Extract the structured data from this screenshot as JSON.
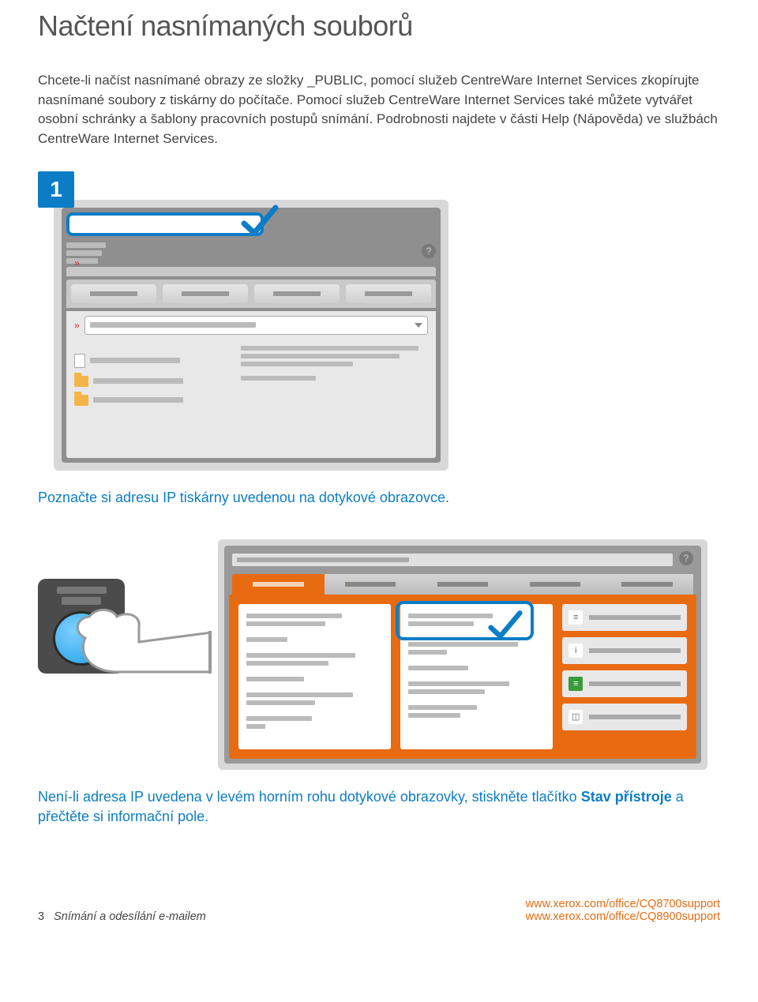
{
  "title": "Načtení nasnímaných souborů",
  "intro": "Chcete-li načíst nasnímané obrazy ze složky _PUBLIC, pomocí služeb CentreWare Internet Services zkopírujte nasnímané soubory z tiskárny do počítače. Pomocí služeb CentreWare Internet Services také můžete vytvářet osobní schránky a šablony pracovních postupů snímání. Podrobnosti najdete v části Help (Nápověda) ve službách CentreWare Internet Services.",
  "step1": {
    "number": "1",
    "note": "Poznačte si adresu IP tiskárny uvedenou na dotykové obrazovce."
  },
  "step2": {
    "note_pre": "Není-li adresa IP uvedena v levém horním rohu dotykové obrazovky, stiskněte tlačítko ",
    "note_bold": "Stav přístroje",
    "note_post": " a přečtěte si informační pole."
  },
  "icons": {
    "help": "?"
  },
  "footer": {
    "page": "3",
    "doc": "Snímání a odesílání e-mailem",
    "url1": "www.xerox.com/office/CQ8700support",
    "url2": "www.xerox.com/office/CQ8900support"
  }
}
